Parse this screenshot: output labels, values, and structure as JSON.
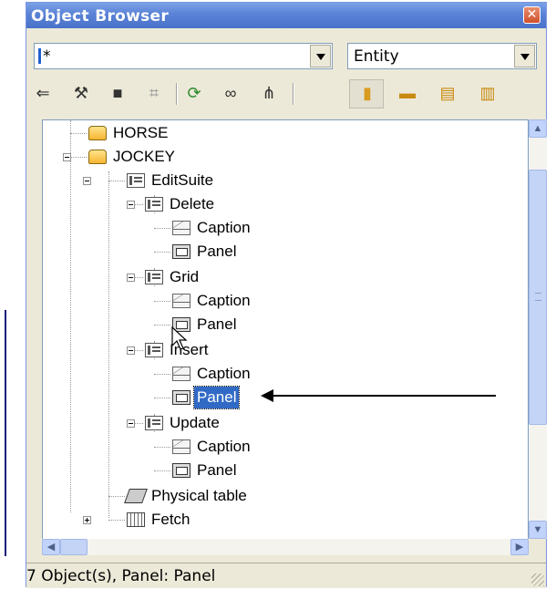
{
  "window": {
    "title": "Object Browser"
  },
  "filter": {
    "text_value": "*",
    "type_value": "Entity"
  },
  "toolbar": {
    "icons": [
      "back-icon",
      "hammer-icon",
      "tree-mark-icon",
      "network-icon",
      "refresh-icon",
      "chain-icon",
      "hierarchy-icon",
      "entity-icon",
      "ruler-icon",
      "form-icon",
      "component-icon"
    ]
  },
  "tree": {
    "items": [
      {
        "label": "HORSE"
      },
      {
        "label": "JOCKEY"
      },
      {
        "label": "EditSuite"
      },
      {
        "label": "Delete"
      },
      {
        "label": "Caption"
      },
      {
        "label": "Panel"
      },
      {
        "label": "Grid"
      },
      {
        "label": "Caption"
      },
      {
        "label": "Panel"
      },
      {
        "label": "Insert"
      },
      {
        "label": "Caption"
      },
      {
        "label": "Panel"
      },
      {
        "label": "Update"
      },
      {
        "label": "Caption"
      },
      {
        "label": "Panel"
      },
      {
        "label": "Physical table"
      },
      {
        "label": "Fetch"
      }
    ],
    "selected_index": 11
  },
  "status": {
    "text": "7 Object(s), Panel: Panel"
  },
  "colors": {
    "title_bar": "#5a82d6",
    "selection": "#316ac5",
    "window_bg": "#ece9d8"
  }
}
